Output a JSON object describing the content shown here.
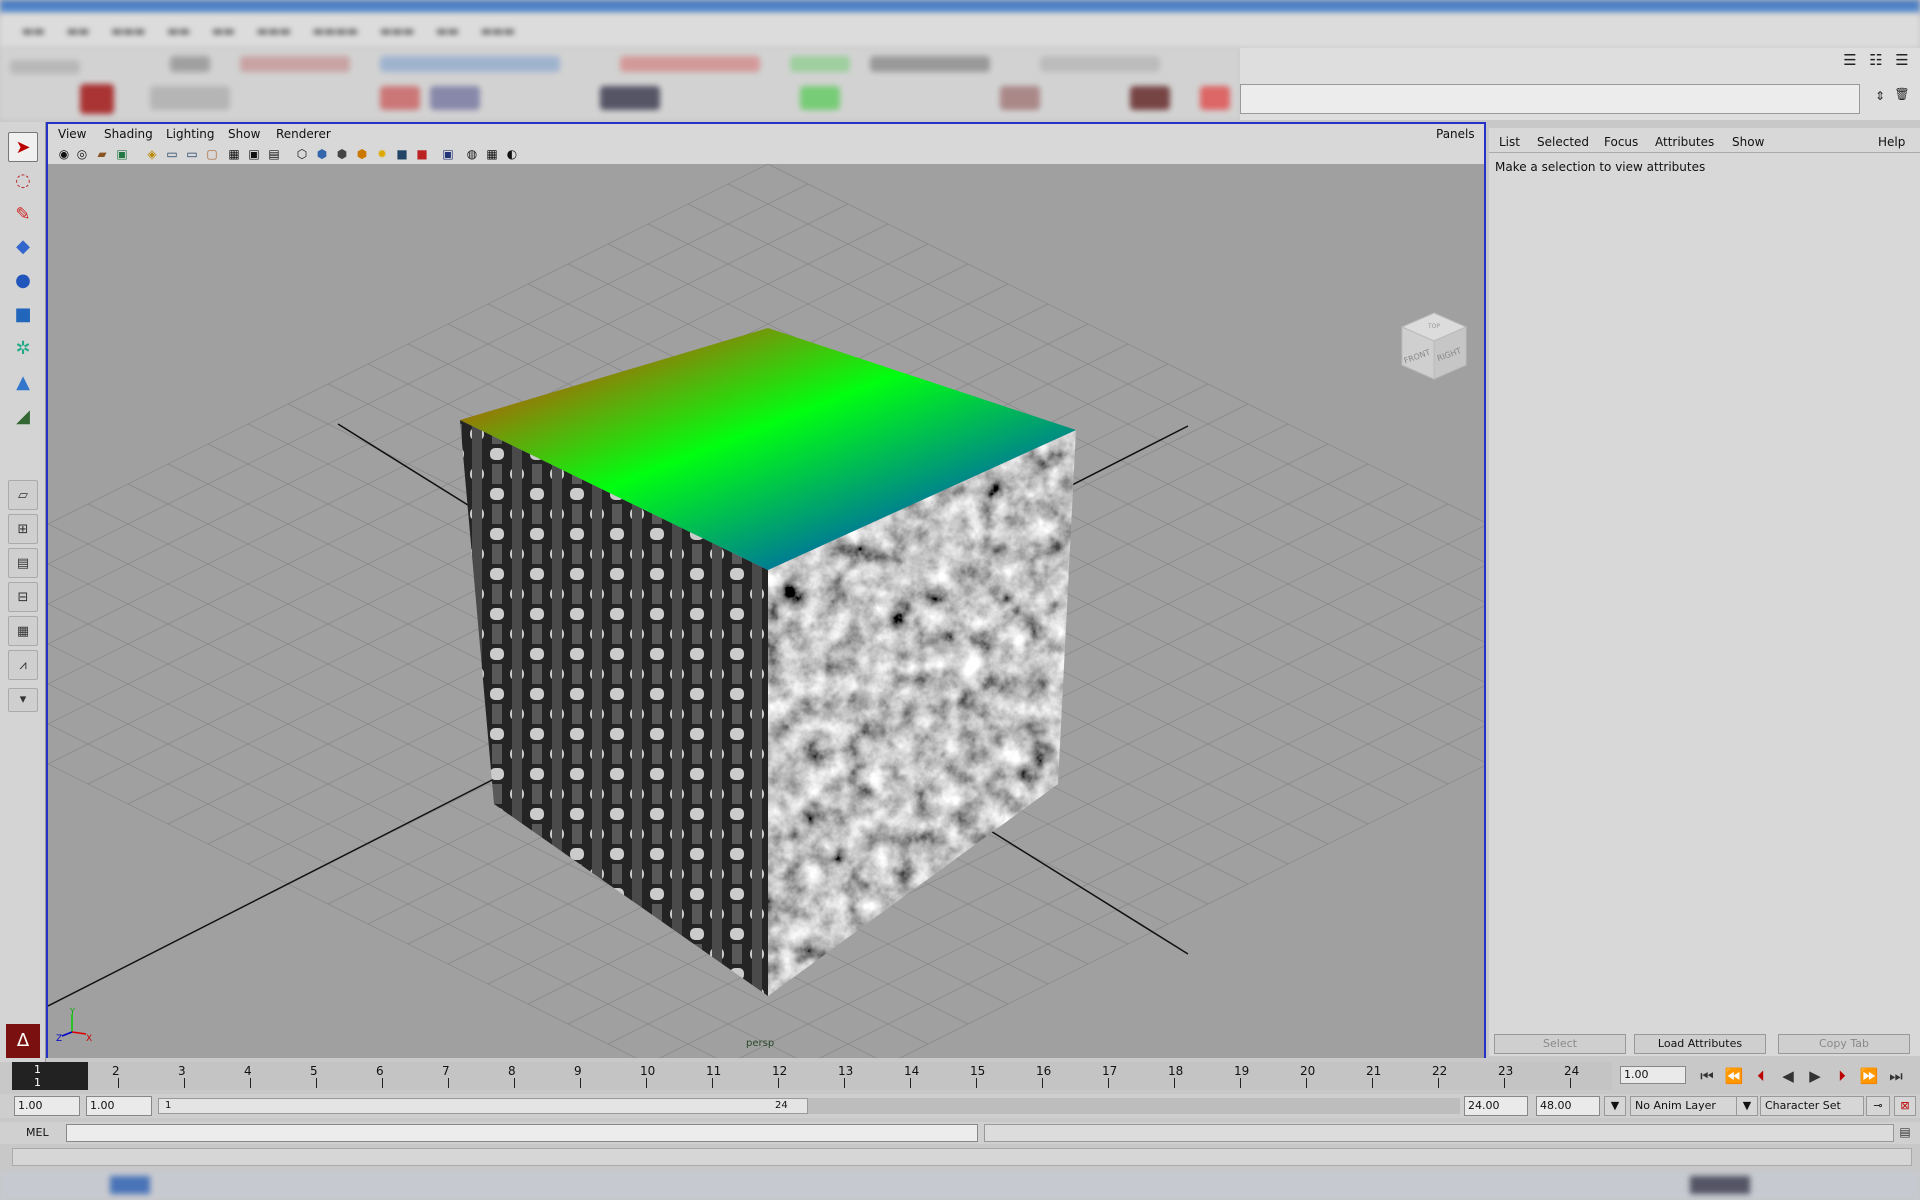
{
  "viewport": {
    "menu": [
      "View",
      "Shading",
      "Lighting",
      "Show",
      "Renderer"
    ],
    "panels_label": "Panels",
    "camera_label": "persp",
    "view_cube": {
      "front_label": "FRONT",
      "right_label": "RIGHT",
      "top_label": "TOP"
    },
    "axis": {
      "y": "Y",
      "z": "Z",
      "x": "X"
    }
  },
  "attribute_editor": {
    "menu": [
      "List",
      "Selected",
      "Focus",
      "Attributes",
      "Show"
    ],
    "help_label": "Help",
    "message": "Make a selection to view attributes",
    "buttons": {
      "select": "Select",
      "load": "Load Attributes",
      "copy": "Copy Tab"
    }
  },
  "timeline": {
    "frame_numbers": [
      "1",
      "2",
      "3",
      "4",
      "5",
      "6",
      "7",
      "8",
      "9",
      "10",
      "11",
      "12",
      "13",
      "14",
      "15",
      "16",
      "17",
      "18",
      "19",
      "20",
      "21",
      "22",
      "23",
      "24"
    ],
    "current_frame": "1",
    "current_frame_field": "1.00"
  },
  "range": {
    "start_field": "1.00",
    "playback_start_field": "1.00",
    "slider_start": "1",
    "slider_end": "24",
    "playback_end_field": "24.00",
    "end_field": "48.00",
    "anim_layer": "No Anim Layer",
    "character_set": "Character Set"
  },
  "command": {
    "mel_label": "MEL"
  },
  "icons": {
    "tools": [
      "select-arrow-icon",
      "lasso-icon",
      "paint-select-icon",
      "move-icon",
      "rotate-icon",
      "scale-icon",
      "universal-manip-icon",
      "soft-mod-icon",
      "show-manip-icon"
    ],
    "layouts": [
      "single-pane-icon",
      "four-pane-icon",
      "outliner-pane-icon",
      "persp-graph-icon",
      "persp-outliner-icon",
      "graph-editor-icon",
      "more-layouts-icon"
    ],
    "playback": [
      "go-to-start-icon",
      "step-back-key-icon",
      "step-back-frame-icon",
      "play-back-icon",
      "play-forward-icon",
      "step-forward-key-icon",
      "go-to-end-icon"
    ]
  },
  "colors": {
    "viewport_border": "#2432c8",
    "viewport_bg": "#a0a0a0",
    "grid": "#8a8a8a"
  }
}
